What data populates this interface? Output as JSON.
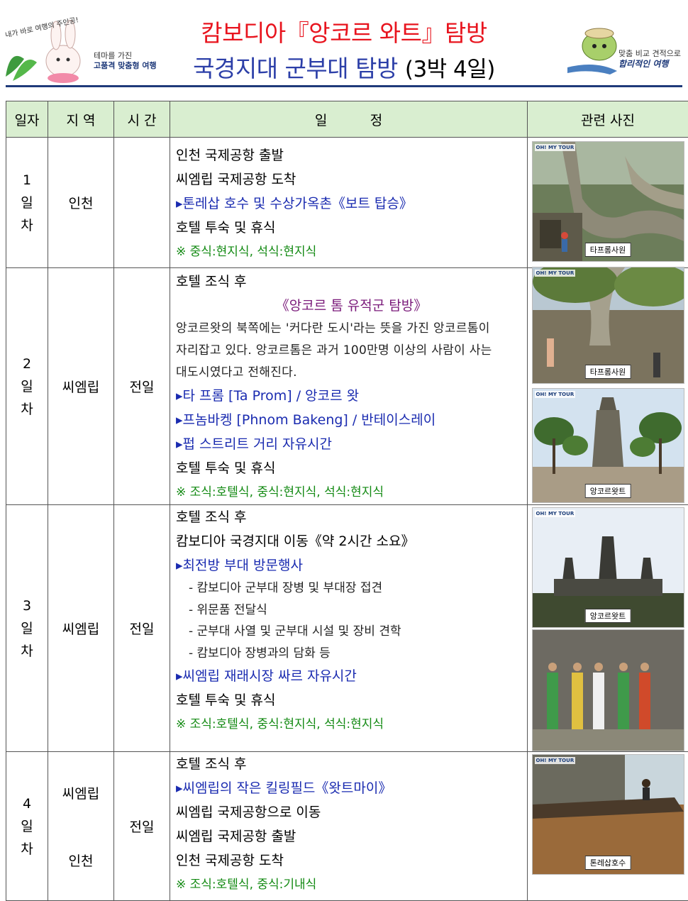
{
  "header": {
    "title_line1": "캄보디아『앙코르 와트』탐방",
    "title_line2": "국경지대 군부대 탐방",
    "title_suffix": "(3박 4일)",
    "left_logo_script": "내가 바로 여행의 주인공!",
    "left_tag1": "테마를 가진",
    "left_tag2": "고품격 맞춤형 여행",
    "right_tag1": "맞춤 비교 견적으로",
    "right_tag2": "합리적인 여행"
  },
  "table": {
    "headers": [
      "일자",
      "지 역",
      "시 간",
      "일          정",
      "관련 사진"
    ],
    "days": [
      {
        "day": [
          "1",
          "일",
          "차"
        ],
        "area": "인천",
        "time": "",
        "lines": [
          {
            "t": "인천 국제공항 출발",
            "s": "normal"
          },
          {
            "t": "씨엠립 국제공항 도착",
            "s": "normal"
          },
          {
            "t": "▸톤레삽 호수 및 수상가옥촌《보트 탑승》",
            "s": "blue"
          },
          {
            "t": "호텔 투숙 및 휴식",
            "s": "normal"
          },
          {
            "t": "※ 중식:현지식, 석식:현지식",
            "s": "green"
          }
        ]
      },
      {
        "day": [
          "2",
          "일",
          "차"
        ],
        "area": "씨엠립",
        "time": "전일",
        "lines_a": [
          {
            "t": "호텔 조식 후",
            "s": "normal"
          },
          {
            "t": "《앙코르 톰 유적군 탐방》",
            "s": "center"
          }
        ],
        "para": "앙코르왓의 북쪽에는 '커다란 도시'라는 뜻을 가진 앙코르톰이 자리잡고 있다. 앙코르톰은 과거 100만명 이상의 사람이 사는 대도시였다고 전해진다.",
        "lines_b": [
          {
            "t": "▸타 프롬 [Ta Prom] / 앙코르 왓",
            "s": "blue"
          },
          {
            "t": "▸프놈바켕 [Phnom Bakeng] / 반테이스레이",
            "s": "blue"
          },
          {
            "t": "▸펍 스트리트 거리 자유시간",
            "s": "blue"
          },
          {
            "t": "호텔 투숙 및 휴식",
            "s": "normal"
          },
          {
            "t": "※ 조식:호텔식, 중식:현지식, 석식:현지식",
            "s": "green"
          }
        ]
      },
      {
        "day": [
          "3",
          "일",
          "차"
        ],
        "area": "씨엠립",
        "time": "전일",
        "lines_a": [
          {
            "t": "호텔 조식 후",
            "s": "normal"
          },
          {
            "t": "캄보디아 국경지대 이동《약 2시간 소요》",
            "s": "normal"
          },
          {
            "t": "▸최전방 부대 방문행사",
            "s": "blue"
          }
        ],
        "subs": [
          "- 캄보디아 군부대 장병 및 부대장 접견",
          "- 위문품 전달식",
          "- 군부대 사열 및 군부대 시설 및 장비 견학",
          "- 캄보디아 장병과의 담화 등"
        ],
        "lines_b": [
          {
            "t": "▸씨엠립 재래시장 싸르 자유시간",
            "s": "blue"
          },
          {
            "t": "호텔 투숙 및 휴식",
            "s": "normal"
          },
          {
            "t": "※ 조식:호텔식, 중식:현지식, 석식:현지식",
            "s": "green"
          }
        ]
      },
      {
        "day": [
          "4",
          "일",
          "차"
        ],
        "area1": "씨엠립",
        "area2": "인천",
        "time": "전일",
        "lines": [
          {
            "t": "호텔 조식 후",
            "s": "normal"
          },
          {
            "t": "▸씨엠립의 작은 킬링필드《왓트마이》",
            "s": "blue"
          },
          {
            "t": "씨엠립 국제공항으로 이동",
            "s": "normal"
          },
          {
            "t": "씨엠립 국제공항 출발",
            "s": "normal"
          },
          {
            "t": "인천 국제공항 도착",
            "s": "normal"
          },
          {
            "t": "※ 조식:호텔식, 중식:기내식",
            "s": "green"
          }
        ]
      }
    ],
    "photos": {
      "watermark": "OH! MY TOUR",
      "p1": "타프롬사원",
      "p2": "타프롬사원",
      "p3": "앙코르왓트",
      "p4": "앙코르왓트",
      "p5": "",
      "p6": "톤레삽호수"
    }
  },
  "colors": {
    "title_red": "#e8141e",
    "title_blue": "#2c3fa8",
    "header_bg": "#d9eed0",
    "link_blue": "#1a2bb0",
    "meal_green": "#138a13",
    "subtitle_purple": "#7a1a7a"
  }
}
